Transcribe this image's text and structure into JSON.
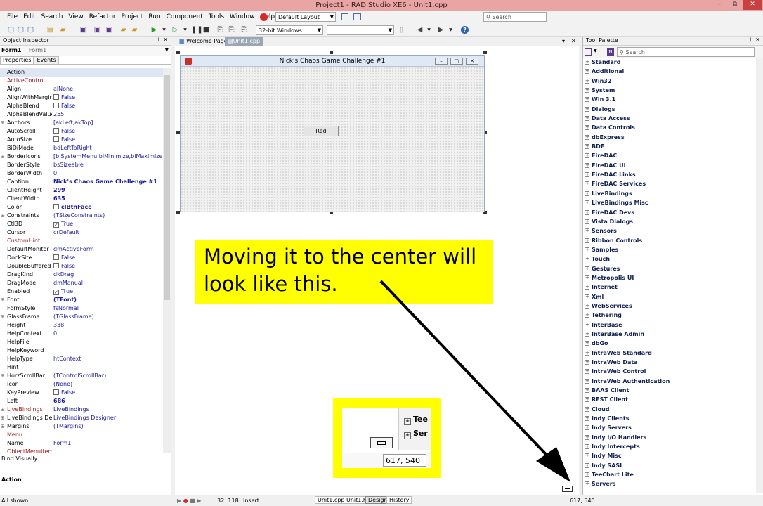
{
  "window": {
    "title": "Project1 - RAD Studio XE6 - Unit1.cpp",
    "min": "–",
    "max": "⧉",
    "close": "✕"
  },
  "menu": [
    "File",
    "Edit",
    "Search",
    "View",
    "Refactor",
    "Project",
    "Run",
    "Component",
    "Tools",
    "Window",
    "Help"
  ],
  "toolbar": {
    "layout": "Default Layout",
    "search_placeholder": "Search",
    "platform": "32-bit Windows",
    "config": ""
  },
  "object_inspector": {
    "title": "Object Inspector",
    "selected_name": "Form1",
    "selected_type": "TForm1",
    "tab_properties": "Properties",
    "tab_events": "Events",
    "properties": [
      {
        "name": "Action",
        "value": "",
        "hdr": true
      },
      {
        "name": "ActiveControl",
        "value": "",
        "ev": true
      },
      {
        "name": "Align",
        "value": "alNone"
      },
      {
        "name": "AlignWithMargins",
        "value": "False",
        "cb": " "
      },
      {
        "name": "AlphaBlend",
        "value": "False",
        "cb": " "
      },
      {
        "name": "AlphaBlendValue",
        "value": "255"
      },
      {
        "name": "Anchors",
        "value": "[akLeft,akTop]",
        "exp": true
      },
      {
        "name": "AutoScroll",
        "value": "False",
        "cb": " "
      },
      {
        "name": "AutoSize",
        "value": "False",
        "cb": " "
      },
      {
        "name": "BiDiMode",
        "value": "bdLeftToRight"
      },
      {
        "name": "BorderIcons",
        "value": "[biSystemMenu,biMinimize,biMaximize]",
        "exp": true
      },
      {
        "name": "BorderStyle",
        "value": "bsSizeable"
      },
      {
        "name": "BorderWidth",
        "value": "0"
      },
      {
        "name": "Caption",
        "value": "Nick's Chaos Game Challenge #1",
        "b": true
      },
      {
        "name": "ClientHeight",
        "value": "299",
        "b": true
      },
      {
        "name": "ClientWidth",
        "value": "635",
        "b": true
      },
      {
        "name": "Color",
        "value": "clBtnFace",
        "cb": " ",
        "b": true
      },
      {
        "name": "Constraints",
        "value": "(TSizeConstraints)",
        "exp": true
      },
      {
        "name": "Ctl3D",
        "value": "True",
        "cb": "✓"
      },
      {
        "name": "Cursor",
        "value": "crDefault"
      },
      {
        "name": "CustomHint",
        "value": "",
        "ev": true
      },
      {
        "name": "DefaultMonitor",
        "value": "dmActiveForm"
      },
      {
        "name": "DockSite",
        "value": "False",
        "cb": " "
      },
      {
        "name": "DoubleBuffered",
        "value": "False",
        "cb": " "
      },
      {
        "name": "DragKind",
        "value": "dkDrag"
      },
      {
        "name": "DragMode",
        "value": "dmManual"
      },
      {
        "name": "Enabled",
        "value": "True",
        "cb": "✓"
      },
      {
        "name": "Font",
        "value": "(TFont)",
        "exp": true,
        "b": true
      },
      {
        "name": "FormStyle",
        "value": "fsNormal"
      },
      {
        "name": "GlassFrame",
        "value": "(TGlassFrame)",
        "exp": true
      },
      {
        "name": "Height",
        "value": "338"
      },
      {
        "name": "HelpContext",
        "value": "0"
      },
      {
        "name": "HelpFile",
        "value": ""
      },
      {
        "name": "HelpKeyword",
        "value": ""
      },
      {
        "name": "HelpType",
        "value": "htContext"
      },
      {
        "name": "Hint",
        "value": ""
      },
      {
        "name": "HorzScrollBar",
        "value": "(TControlScrollBar)",
        "exp": true
      },
      {
        "name": "Icon",
        "value": "(None)"
      },
      {
        "name": "KeyPreview",
        "value": "False",
        "cb": " "
      },
      {
        "name": "Left",
        "value": "686",
        "b": true
      },
      {
        "name": "LiveBindings",
        "value": "LiveBindings",
        "exp": true,
        "ev": true
      },
      {
        "name": "LiveBindings Desig",
        "value": "LiveBindings Designer",
        "exp": true
      },
      {
        "name": "Margins",
        "value": "(TMargins)",
        "exp": true
      },
      {
        "name": "Menu",
        "value": "",
        "ev": true
      },
      {
        "name": "Name",
        "value": "Form1"
      },
      {
        "name": "ObjectMenuItem",
        "value": "",
        "ev": true
      }
    ],
    "bind_visually": "Bind Visually...",
    "action_label": "Action"
  },
  "editor": {
    "tab_welcome": "Welcome Page",
    "tab_unit": "Unit1.cpp",
    "form_caption": "Nick's Chaos Game Challenge #1",
    "button_caption": "Red",
    "note_text": "Moving it to the center will look like this.",
    "inset_tree_1": "Tee",
    "inset_tree_2": "Ser",
    "inset_coords": "617, 540"
  },
  "statusbar": {
    "left": "All shown",
    "position": "32: 118",
    "mode": "Insert",
    "tabs": [
      "Unit1.cpp",
      "Unit1.h",
      "Design",
      "History"
    ],
    "coords": "617, 540"
  },
  "tool_palette": {
    "title": "Tool Palette",
    "search_placeholder": "Search",
    "categories": [
      "Standard",
      "Additional",
      "Win32",
      "System",
      "Win 3.1",
      "Dialogs",
      "Data Access",
      "Data Controls",
      "dbExpress",
      "BDE",
      "FireDAC",
      "FireDAC UI",
      "FireDAC Links",
      "FireDAC Services",
      "LiveBindings",
      "LiveBindings Misc",
      "FireDAC Devs",
      "Vista Dialogs",
      "Sensors",
      "Ribbon Controls",
      "Samples",
      "Touch",
      "Gestures",
      "Metropolis UI",
      "Internet",
      "Xml",
      "WebServices",
      "Tethering",
      "InterBase",
      "InterBase Admin",
      "dbGo",
      "IntraWeb Standard",
      "IntraWeb Data",
      "IntraWeb Control",
      "IntraWeb Authentication",
      "BAAS Client",
      "REST Client",
      "Cloud",
      "Indy Clients",
      "Indy Servers",
      "Indy I/O Handlers",
      "Indy Intercepts",
      "Indy Misc",
      "Indy SASL",
      "TeeChart Lite",
      "Servers"
    ]
  },
  "colors": {
    "title_bg": "#e9a4a4",
    "note_bg": "#ffff00",
    "arrow": "#000000"
  }
}
